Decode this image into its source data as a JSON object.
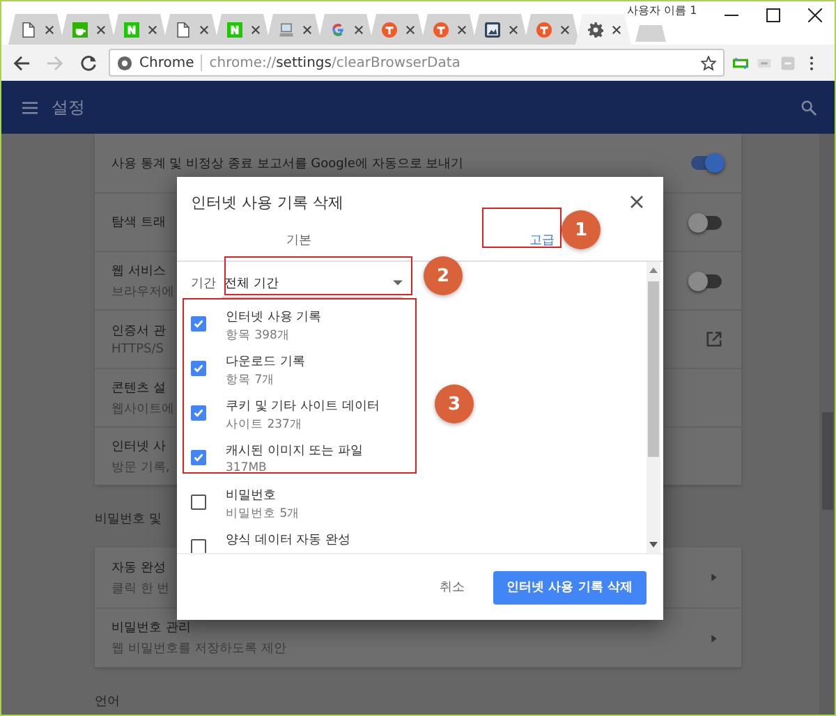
{
  "window": {
    "profile": "사용자 이름 1"
  },
  "tabs": [
    {
      "kind": "page",
      "selected": false
    },
    {
      "kind": "cup",
      "selected": false
    },
    {
      "kind": "n-logo",
      "selected": false
    },
    {
      "kind": "page",
      "selected": false
    },
    {
      "kind": "n-logo",
      "selected": false
    },
    {
      "kind": "computer",
      "selected": false
    },
    {
      "kind": "g-logo",
      "selected": false
    },
    {
      "kind": "t-logo",
      "selected": false
    },
    {
      "kind": "t-logo",
      "selected": false
    },
    {
      "kind": "image",
      "selected": false
    },
    {
      "kind": "t-logo",
      "selected": false
    },
    {
      "kind": "gear",
      "selected": true
    }
  ],
  "toolbar": {
    "forward_disabled": true,
    "site_label": "Chrome",
    "url": "chrome://**settings**/clearBrowserData"
  },
  "header": {
    "title": "설정"
  },
  "settings": {
    "rows": [
      {
        "title": "사용 통계 및 비정상 종료 보고서를 Google에 자동으로 보내기",
        "control": {
          "kind": "toggle",
          "on": true
        }
      },
      {
        "title": "탐색 트래",
        "control": {
          "kind": "toggle",
          "on": false
        }
      },
      {
        "title": "웹 서비스",
        "subtitle": "브라우저에",
        "control": {
          "kind": "toggle",
          "on": false
        }
      },
      {
        "title": "인증서 관",
        "subtitle": "HTTPS/S",
        "control": {
          "kind": "external"
        }
      },
      {
        "title": "콘텐츠 설",
        "subtitle": "웹사이트에"
      },
      {
        "title": "인터넷 사",
        "subtitle": "방문 기록,"
      }
    ],
    "section": "비밀번호 및",
    "rows2": [
      {
        "title": "자동 완성",
        "subtitle": "클릭 한 번",
        "control": {
          "kind": "arrow"
        }
      },
      {
        "title": "비밀번호 관리",
        "subtitle": "웹 비밀번호를 저장하도록 제안",
        "control": {
          "kind": "arrow"
        }
      }
    ],
    "next_section": "언어"
  },
  "dialog": {
    "title": "인터넷 사용 기록 삭제",
    "tabs": [
      {
        "label": "기본",
        "selected": false
      },
      {
        "label": "고급",
        "selected": true
      }
    ],
    "period": {
      "label": "기간",
      "value": "전체 기간"
    },
    "items": [
      {
        "label": "인터넷 사용 기록",
        "detail": "항목 398개",
        "checked": true
      },
      {
        "label": "다운로드 기록",
        "detail": "항목 7개",
        "checked": true
      },
      {
        "label": "쿠키 및 기타 사이트 데이터",
        "detail": "사이트 237개",
        "checked": true
      },
      {
        "label": "캐시된 이미지 또는 파일",
        "detail": "317MB",
        "checked": true
      },
      {
        "label": "비밀번호",
        "detail": "비밀번호 5개",
        "checked": false
      },
      {
        "label": "양식 데이터 자동 완성",
        "checked": false
      }
    ],
    "buttons": [
      {
        "label": "취소",
        "kind": "text"
      },
      {
        "label": "인터넷 사용 기록 삭제",
        "kind": "primary"
      }
    ]
  },
  "annotations": [
    {
      "label": "1"
    },
    {
      "label": "2"
    },
    {
      "label": "3"
    }
  ]
}
